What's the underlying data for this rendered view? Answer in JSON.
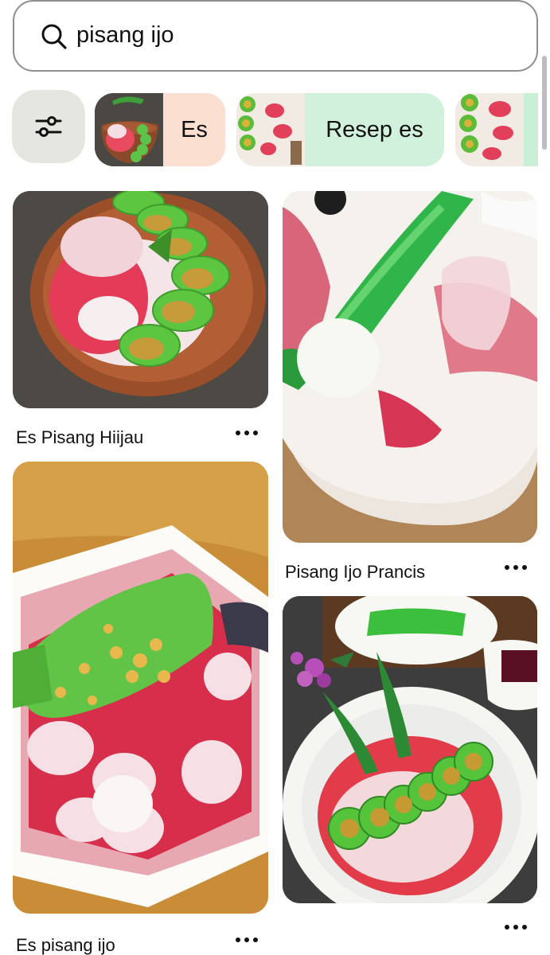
{
  "search": {
    "query": "pisang ijo"
  },
  "chips": [
    {
      "label": "Es",
      "color": "#fbe0d2"
    },
    {
      "label": "Resep es",
      "color": "#d2f1dd"
    },
    {
      "label": "",
      "color": "#c9efd7"
    }
  ],
  "pins": [
    {
      "title": "Es Pisang Hiijau"
    },
    {
      "title": "Pisang Ijo Prancis"
    },
    {
      "title": "Es pisang ijo"
    }
  ],
  "colors": {
    "chip_es": "#fbe0d2",
    "chip_resep": "#d2f1dd",
    "filter_bg": "#e6e6e1",
    "border": "#8e8e8e"
  }
}
